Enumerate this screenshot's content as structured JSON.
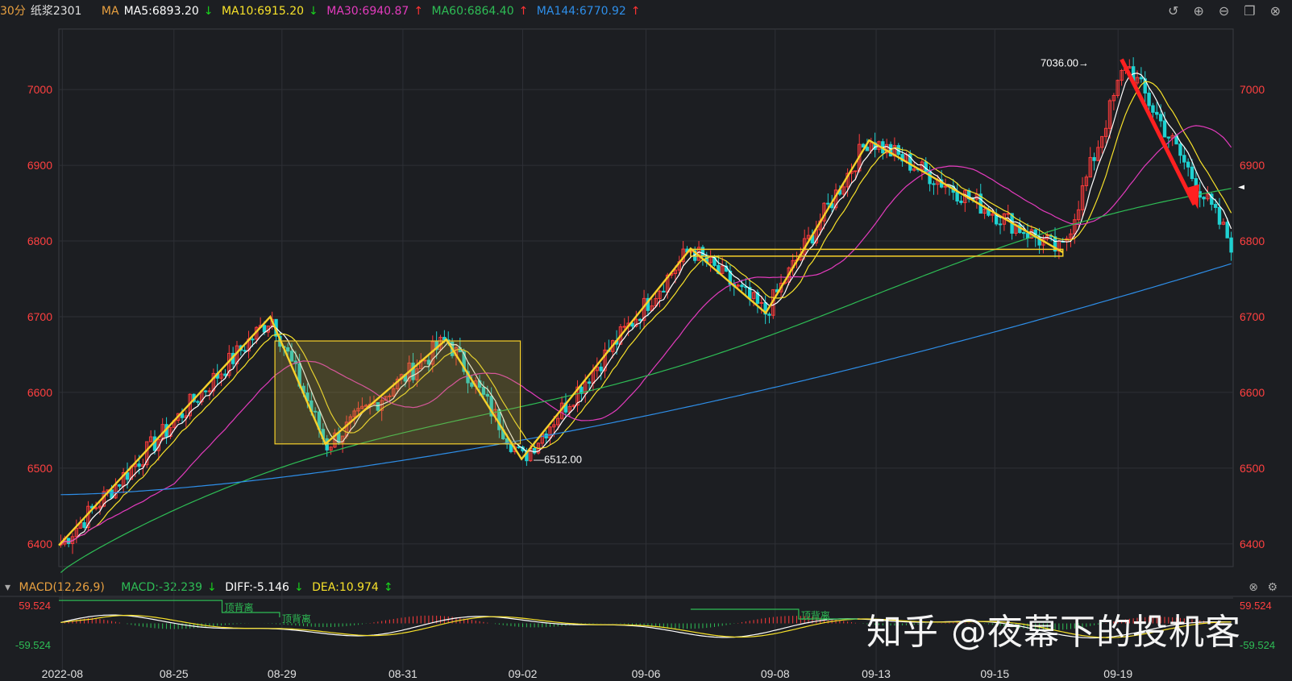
{
  "header": {
    "period": "30分",
    "symbol": "纸浆2301",
    "ma_label": "MA",
    "ma": [
      {
        "label": "MA5:6893.20",
        "dir": "down",
        "color": "#ffffff"
      },
      {
        "label": "MA10:6915.20",
        "dir": "down",
        "color": "#f7e12a"
      },
      {
        "label": "MA30:6940.87",
        "dir": "up",
        "color": "#e33bbd"
      },
      {
        "label": "MA60:6864.40",
        "dir": "up",
        "color": "#2ebd55"
      },
      {
        "label": "MA144:6770.92",
        "dir": "up",
        "color": "#2e8ee8"
      }
    ],
    "icons": [
      "undo-icon",
      "zoom-in-icon",
      "zoom-out-icon",
      "window-icon",
      "close-icon"
    ]
  },
  "macd": {
    "title": "MACD(12,26,9)",
    "macd_label": "MACD:-32.239",
    "diff_label": "DIFF:-5.146",
    "dea_label": "DEA:10.974",
    "upper": "59.524",
    "lower": "-59.524",
    "div_label_1": "顶背离",
    "div_label_2": "顶背离",
    "div_label_3": "顶背离"
  },
  "annotations": {
    "high_label": "7036.00",
    "low_label": "6512.00"
  },
  "watermark": "知乎 @夜幕下的投机客",
  "chart_data": {
    "type": "candlestick",
    "ylim": [
      6370,
      7080
    ],
    "y_ticks": [
      "7000",
      "6900",
      "6800",
      "6700",
      "6600",
      "6500",
      "6400"
    ],
    "x_labels": [
      "2022-08",
      "08-25",
      "08-29",
      "08-31",
      "09-02",
      "09-06",
      "09-08",
      "09-13",
      "09-15",
      "09-19"
    ],
    "series": [
      {
        "name": "MA5",
        "value": 6893.2
      },
      {
        "name": "MA10",
        "value": 6915.2
      },
      {
        "name": "MA30",
        "value": 6940.87
      },
      {
        "name": "MA60",
        "value": 6864.4
      },
      {
        "name": "MA144",
        "value": 6770.92
      }
    ],
    "pivots": [
      6400,
      6700,
      6530,
      6670,
      6512,
      6790,
      6705,
      6935,
      6785,
      7036,
      6850
    ],
    "high": 7036.0,
    "low": 6512.0,
    "grid": true
  }
}
